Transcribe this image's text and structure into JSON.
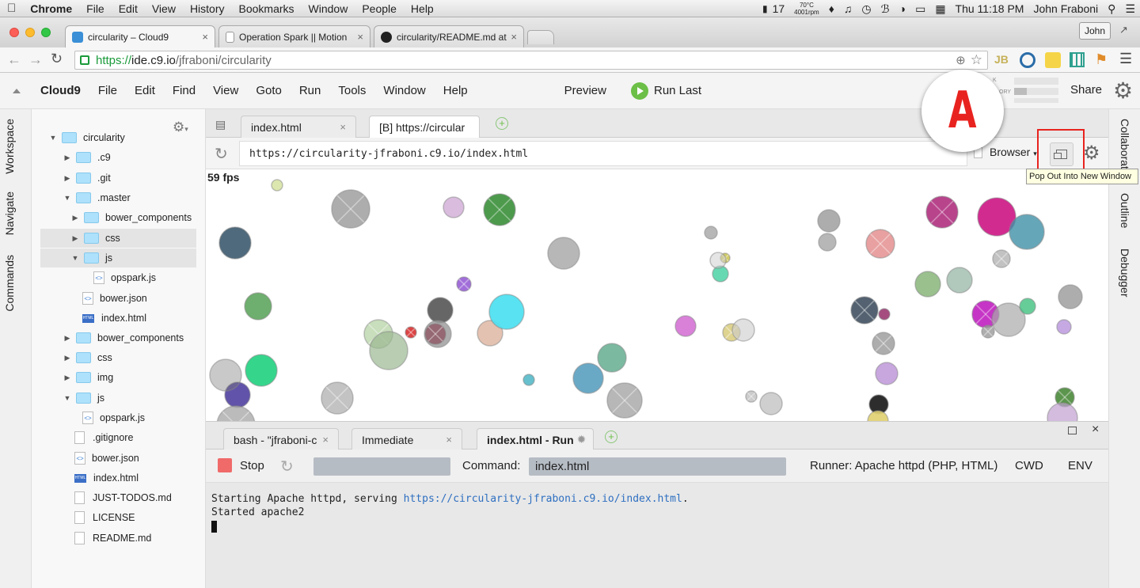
{
  "macos": {
    "app": "Chrome",
    "menu": [
      "File",
      "Edit",
      "View",
      "History",
      "Bookmarks",
      "Window",
      "People",
      "Help"
    ],
    "status": {
      "battery_num": "17",
      "temp": "70°C",
      "rpm": "4001rpm",
      "clock": "Thu 11:18 PM",
      "user": "John Fraboni"
    }
  },
  "chrome": {
    "tabs": [
      {
        "label": "circularity – Cloud9",
        "active": true
      },
      {
        "label": "Operation Spark || Motion",
        "active": false
      },
      {
        "label": "circularity/README.md at",
        "active": false
      }
    ],
    "profile": "John",
    "url_https": "https://",
    "url_host": "ide.c9.io",
    "url_path": "/jfraboni/circularity"
  },
  "cloud9": {
    "brand": "Cloud9",
    "menu": [
      "File",
      "Edit",
      "Find",
      "View",
      "Goto",
      "Run",
      "Tools",
      "Window",
      "Help"
    ],
    "preview": "Preview",
    "run_last": "Run Last",
    "share": "Share",
    "partial_k": "K",
    "partial_ory": "ORY"
  },
  "left_rail": [
    "Workspace",
    "Navigate",
    "Commands"
  ],
  "right_rail": [
    "Collaborate",
    "Outline",
    "Debugger"
  ],
  "tree": [
    {
      "label": "circularity",
      "type": "folder",
      "open": true,
      "depth": 0
    },
    {
      "label": ".c9",
      "type": "folder",
      "open": false,
      "depth": 1
    },
    {
      "label": ".git",
      "type": "folder",
      "open": false,
      "depth": 1
    },
    {
      "label": ".master",
      "type": "folder",
      "open": true,
      "depth": 1
    },
    {
      "label": "bower_components",
      "type": "folder",
      "open": false,
      "depth": 2
    },
    {
      "label": "css",
      "type": "folder",
      "open": false,
      "depth": 2,
      "selected": true
    },
    {
      "label": "js",
      "type": "folder",
      "open": true,
      "depth": 2,
      "selected": true
    },
    {
      "label": "opspark.js",
      "type": "js",
      "depth": 3
    },
    {
      "label": "bower.json",
      "type": "js",
      "depth": 2
    },
    {
      "label": "index.html",
      "type": "html",
      "depth": 2
    },
    {
      "label": "bower_components",
      "type": "folder",
      "open": false,
      "depth": 1
    },
    {
      "label": "css",
      "type": "folder",
      "open": false,
      "depth": 1
    },
    {
      "label": "img",
      "type": "folder",
      "open": false,
      "depth": 1
    },
    {
      "label": "js",
      "type": "folder",
      "open": true,
      "depth": 1
    },
    {
      "label": "opspark.js",
      "type": "js",
      "depth": 2
    },
    {
      "label": ".gitignore",
      "type": "txt",
      "depth": 1
    },
    {
      "label": "bower.json",
      "type": "js",
      "depth": 1
    },
    {
      "label": "index.html",
      "type": "html",
      "depth": 1
    },
    {
      "label": "JUST-TODOS.md",
      "type": "txt",
      "depth": 1
    },
    {
      "label": "LICENSE",
      "type": "txt",
      "depth": 1
    },
    {
      "label": "README.md",
      "type": "txt",
      "depth": 1
    }
  ],
  "editor_tabs": [
    {
      "label": "index.html",
      "active": false
    },
    {
      "label": "[B] https://circular",
      "active": true
    }
  ],
  "preview": {
    "url": "https://circularity-jfraboni.c9.io/index.html",
    "browser_label": "Browser",
    "fps": "59 fps",
    "tooltip": "Pop Out Into New Window"
  },
  "terminal_tabs": [
    {
      "label": "bash - \"jfraboni-c",
      "active": false
    },
    {
      "label": "Immediate",
      "active": false
    },
    {
      "label": "index.html - Run",
      "active": true
    }
  ],
  "runner": {
    "stop": "Stop",
    "command_label": "Command:",
    "command_value": "index.html",
    "runner_label": "Runner: Apache httpd (PHP, HTML)",
    "cwd": "CWD",
    "env": "ENV"
  },
  "console": {
    "line1_prefix": "Starting Apache httpd, serving ",
    "line1_link": "https://circularity-jfraboni.c9.io/index.html",
    "line1_suffix": ".",
    "line2": "Started apache2"
  },
  "annotation": "A",
  "colors": {
    "run_green": "#6cbf47",
    "stop_red": "#f06a6a",
    "highlight_red": "#e8231f",
    "link_blue": "#2e6fc1"
  }
}
